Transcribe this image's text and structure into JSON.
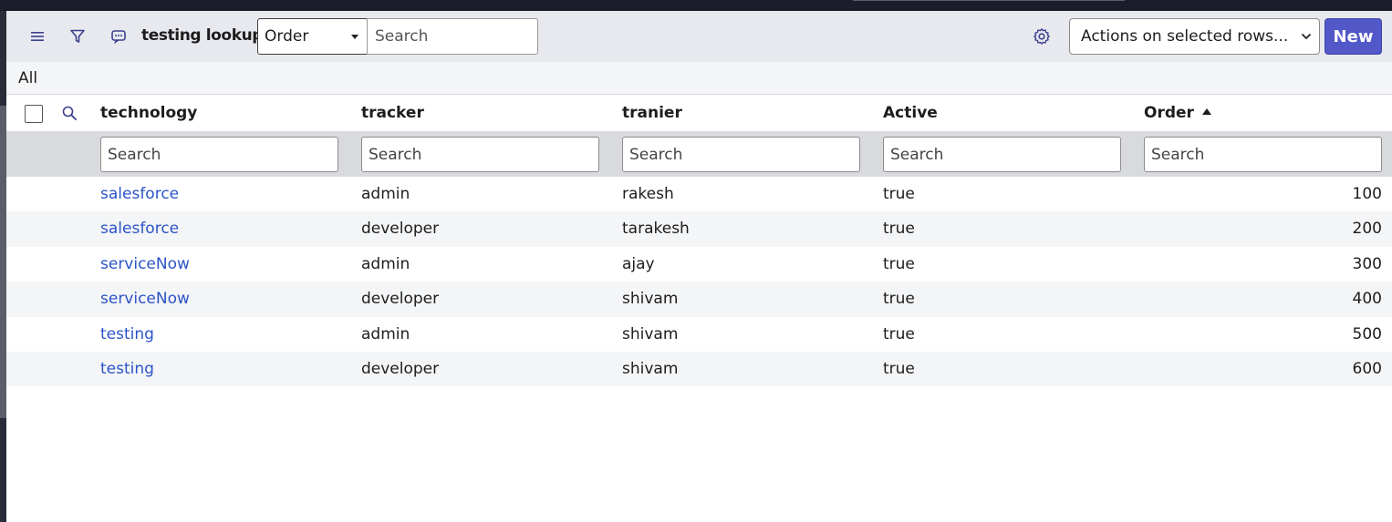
{
  "header": {
    "title": "testing lookups",
    "field_select": "Order",
    "search_placeholder": "Search",
    "actions_select": "Actions on selected rows...",
    "new_label": "New"
  },
  "breadcrumb": {
    "label": "All"
  },
  "columns": [
    {
      "label": "technology"
    },
    {
      "label": "tracker"
    },
    {
      "label": "tranier"
    },
    {
      "label": "Active"
    },
    {
      "label": "Order",
      "sort": "ascending"
    }
  ],
  "column_search_placeholder": "Search",
  "rows": [
    {
      "technology": "salesforce",
      "tracker": "admin",
      "tranier": "rakesh",
      "active": "true",
      "order": "100"
    },
    {
      "technology": "salesforce",
      "tracker": "developer",
      "tranier": "tarakesh",
      "active": "true",
      "order": "200"
    },
    {
      "technology": "serviceNow",
      "tracker": "admin",
      "tranier": "ajay",
      "active": "true",
      "order": "300"
    },
    {
      "technology": "serviceNow",
      "tracker": "developer",
      "tranier": "shivam",
      "active": "true",
      "order": "400"
    },
    {
      "technology": "testing",
      "tracker": "admin",
      "tranier": "shivam",
      "active": "true",
      "order": "500"
    },
    {
      "technology": "testing",
      "tracker": "developer",
      "tranier": "shivam",
      "active": "true",
      "order": "600"
    }
  ],
  "icons": {
    "menu": "hamburger-icon",
    "filter": "filter-icon",
    "chat": "chat-icon",
    "settings": "gear-icon",
    "search": "search-icon",
    "sort": "sort-ascending-icon"
  },
  "colors": {
    "accent": "#5258c8",
    "link": "#2b54c8",
    "header_bg": "#e8e9ee",
    "search_row_bg": "#d9dade"
  }
}
